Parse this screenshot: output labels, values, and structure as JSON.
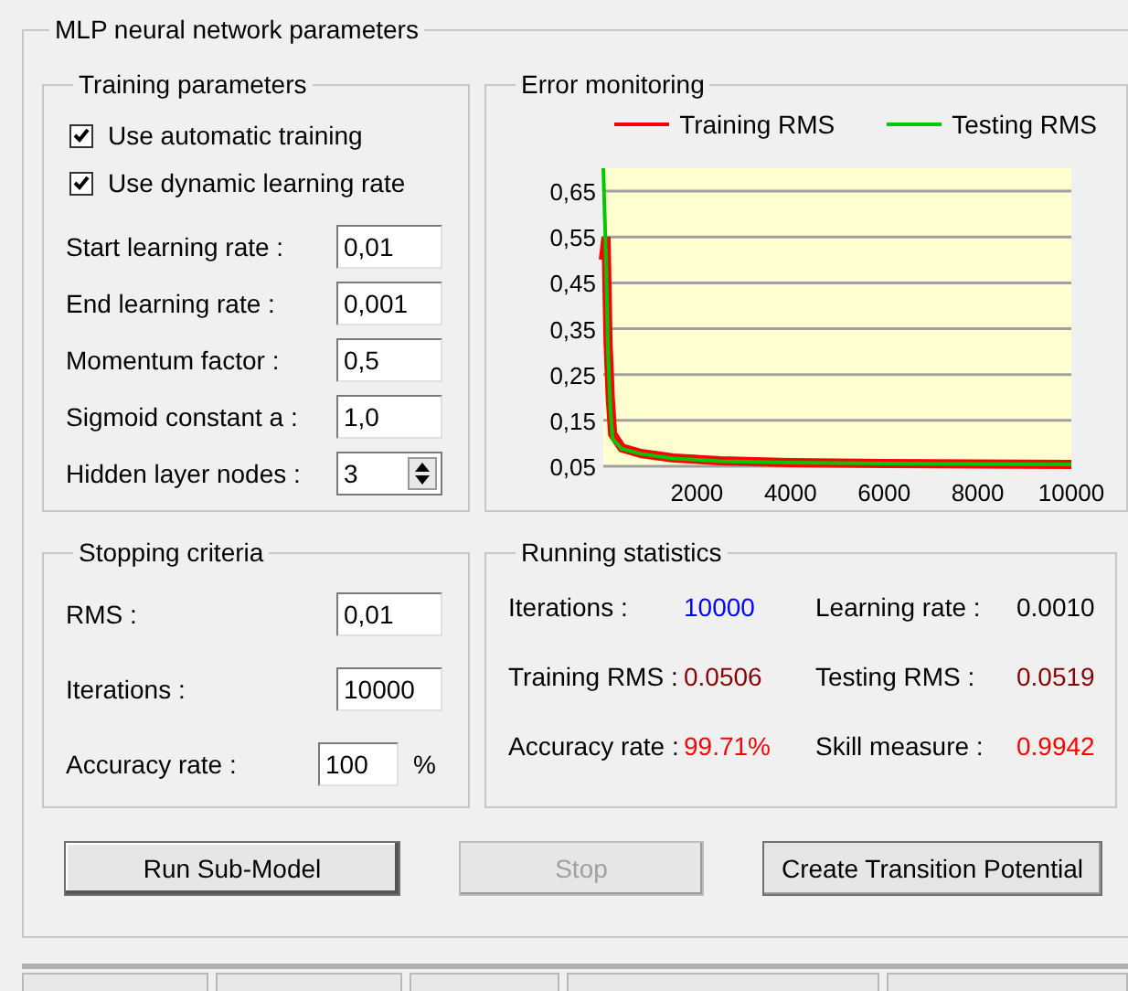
{
  "panel": {
    "title": "MLP neural network parameters"
  },
  "training_parameters": {
    "title": "Training parameters",
    "checkboxes": [
      {
        "label": "Use automatic training",
        "checked": true
      },
      {
        "label": "Use dynamic learning rate",
        "checked": true
      }
    ],
    "fields": [
      {
        "label": "Start learning rate :",
        "value": "0,01",
        "kind": "text"
      },
      {
        "label": "End learning rate :",
        "value": "0,001",
        "kind": "text"
      },
      {
        "label": "Momentum factor :",
        "value": "0,5",
        "kind": "text"
      },
      {
        "label": "Sigmoid constant a :",
        "value": "1,0",
        "kind": "text"
      },
      {
        "label": "Hidden layer nodes :",
        "value": "3",
        "kind": "spinner"
      }
    ]
  },
  "error_monitoring": {
    "title": "Error monitoring",
    "chart_data": {
      "type": "line",
      "grid": true,
      "xlim": [
        0,
        10000
      ],
      "ylim": [
        0.05,
        0.7
      ],
      "xticks": [
        2000,
        4000,
        6000,
        8000,
        10000
      ],
      "yticks": [
        {
          "value": 0.05,
          "label": "0,05"
        },
        {
          "value": 0.15,
          "label": "0,15"
        },
        {
          "value": 0.25,
          "label": "0,25"
        },
        {
          "value": 0.35,
          "label": "0,35"
        },
        {
          "value": 0.45,
          "label": "0,45"
        },
        {
          "value": 0.55,
          "label": "0,55"
        },
        {
          "value": 0.65,
          "label": "0,65"
        }
      ],
      "x": [
        0,
        60,
        100,
        150,
        200,
        400,
        800,
        1500,
        2500,
        4000,
        6000,
        8000,
        10000
      ],
      "series": [
        {
          "name": "Training RMS",
          "color": "#ff0000",
          "values": [
            0.5,
            0.55,
            0.32,
            0.2,
            0.12,
            0.09,
            0.078,
            0.068,
            0.062,
            0.058,
            0.056,
            0.055,
            0.054
          ]
        },
        {
          "name": "Testing RMS",
          "color": "#00c800",
          "values": [
            0.7,
            0.5,
            0.3,
            0.18,
            0.11,
            0.088,
            0.077,
            0.067,
            0.061,
            0.058,
            0.056,
            0.055,
            0.054
          ]
        }
      ]
    }
  },
  "stopping_criteria": {
    "title": "Stopping criteria",
    "fields": [
      {
        "label": "RMS :",
        "value": "0,01"
      },
      {
        "label": "Iterations :",
        "value": "10000"
      },
      {
        "label": "Accuracy rate :",
        "value": "100",
        "unit": "%"
      }
    ]
  },
  "running_statistics": {
    "title": "Running statistics",
    "items": [
      {
        "label": "Iterations :",
        "value": "10000",
        "color": "#0000ff"
      },
      {
        "label": "Learning rate :",
        "value": "0.0010",
        "color": "#000000"
      },
      {
        "label": "Training RMS :",
        "value": "0.0506",
        "color": "#8b0000"
      },
      {
        "label": "Testing RMS :",
        "value": "0.0519",
        "color": "#8b0000"
      },
      {
        "label": "Accuracy rate :",
        "value": "99.71%",
        "color": "#ff0000"
      },
      {
        "label": "Skill measure :",
        "value": "0.9942",
        "color": "#ff0000"
      }
    ]
  },
  "buttons": [
    {
      "label": "Run Sub-Model",
      "disabled": false,
      "default": true
    },
    {
      "label": "Stop",
      "disabled": true,
      "default": false
    },
    {
      "label": "Create Transition Potential",
      "disabled": false,
      "default": false
    }
  ]
}
